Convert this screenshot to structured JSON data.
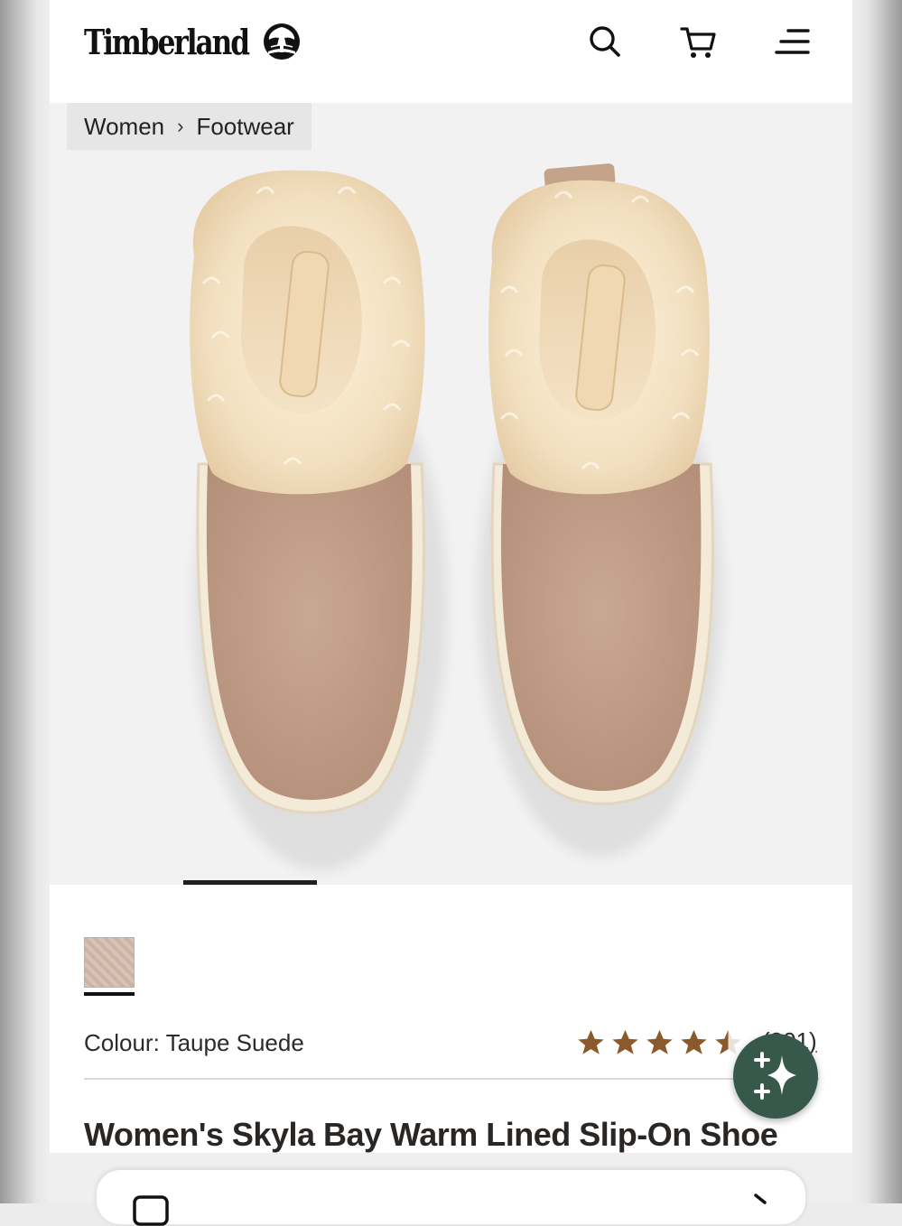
{
  "brand": {
    "name": "Timberland"
  },
  "header": {
    "icons": [
      "search-icon",
      "cart-icon",
      "menu-icon"
    ]
  },
  "breadcrumb": {
    "items": [
      "Women",
      "Footwear"
    ]
  },
  "product": {
    "colour_label": "Colour: Taupe Suede",
    "rating": 4.5,
    "rating_max": 5,
    "review_count": "(301)",
    "title": "Women's Skyla Bay Warm Lined Slip-On Shoe"
  },
  "colors": {
    "fab_bg": "#36594b",
    "star": "#8a5a2b",
    "suede": "#c19d86",
    "fur": "#f3e1c3"
  }
}
